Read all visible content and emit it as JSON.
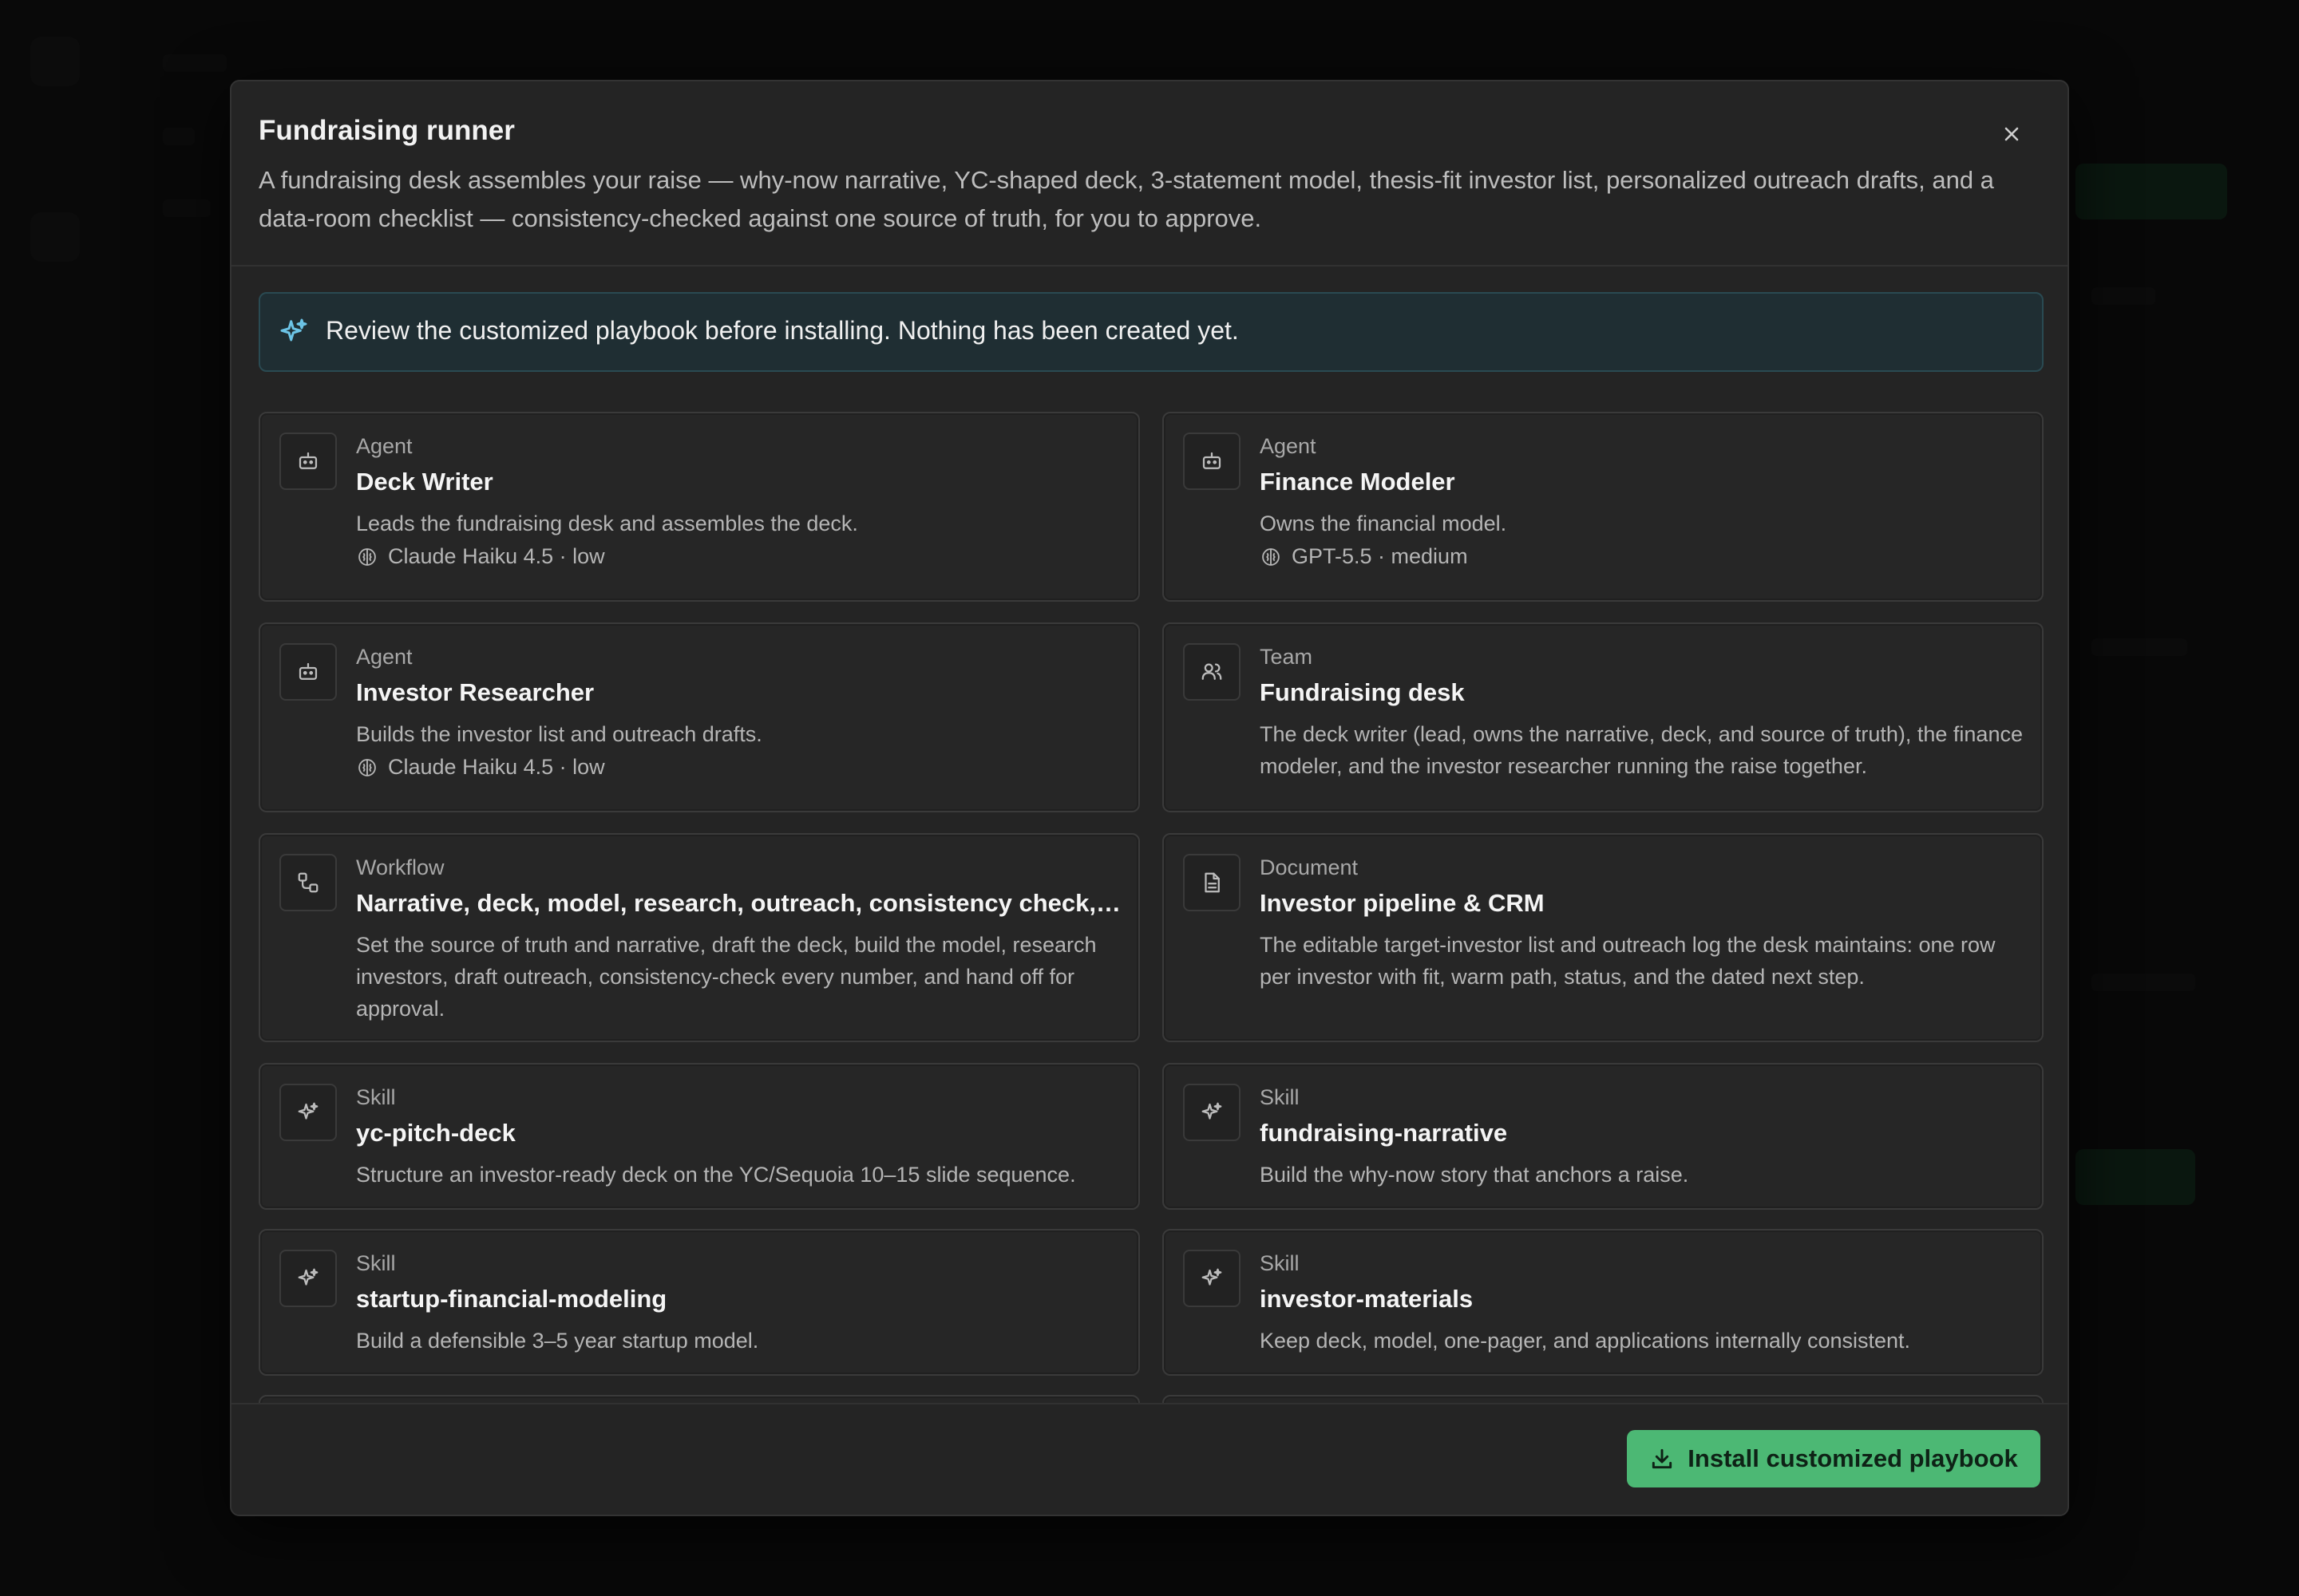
{
  "modal": {
    "title": "Fundraising runner",
    "description": "A fundraising desk assembles your raise — why-now narrative, YC-shaped deck, 3-statement model, thesis-fit investor list, personalized outreach drafts, and a data-room checklist — consistency-checked against one source of truth, for you to approve.",
    "notice": "Review the customized playbook before installing. Nothing has been created yet.",
    "install_label": "Install customized playbook"
  },
  "cards": [
    {
      "type": "Agent",
      "name": "Deck Writer",
      "desc": "Leads the fundraising desk and assembles the deck.",
      "model": "Claude Haiku 4.5 · low",
      "icon": "bot-icon"
    },
    {
      "type": "Agent",
      "name": "Finance Modeler",
      "desc": "Owns the financial model.",
      "model": "GPT-5.5 · medium",
      "icon": "bot-icon"
    },
    {
      "type": "Agent",
      "name": "Investor Researcher",
      "desc": "Builds the investor list and outreach drafts.",
      "model": "Claude Haiku 4.5 · low",
      "icon": "bot-icon"
    },
    {
      "type": "Team",
      "name": "Fundraising desk",
      "desc": "The deck writer (lead, owns the narrative, deck, and source of truth), the finance modeler, and the investor researcher running the raise together.",
      "icon": "users-icon"
    },
    {
      "type": "Workflow",
      "name": "Narrative, deck, model, research, outreach, consistency check, a...",
      "desc": "Set the source of truth and narrative, draft the deck, build the model, research investors, draft outreach, consistency-check every number, and hand off for approval.",
      "icon": "workflow-icon"
    },
    {
      "type": "Document",
      "name": "Investor pipeline & CRM",
      "desc": "The editable target-investor list and outreach log the desk maintains: one row per investor with fit, warm path, status, and the dated next step.",
      "icon": "document-icon"
    },
    {
      "type": "Skill",
      "name": "yc-pitch-deck",
      "desc": "Structure an investor-ready deck on the YC/Sequoia 10–15 slide sequence.",
      "icon": "sparkle-icon"
    },
    {
      "type": "Skill",
      "name": "fundraising-narrative",
      "desc": "Build the why-now story that anchors a raise.",
      "icon": "sparkle-icon"
    },
    {
      "type": "Skill",
      "name": "startup-financial-modeling",
      "desc": "Build a defensible 3–5 year startup model.",
      "icon": "sparkle-icon"
    },
    {
      "type": "Skill",
      "name": "investor-materials",
      "desc": "Keep deck, model, one-pager, and applications internally consistent.",
      "icon": "sparkle-icon"
    }
  ],
  "colors": {
    "accent": "#4cb874",
    "notice_bg": "#1f2e33",
    "notice_icon": "#6cc4e6"
  }
}
